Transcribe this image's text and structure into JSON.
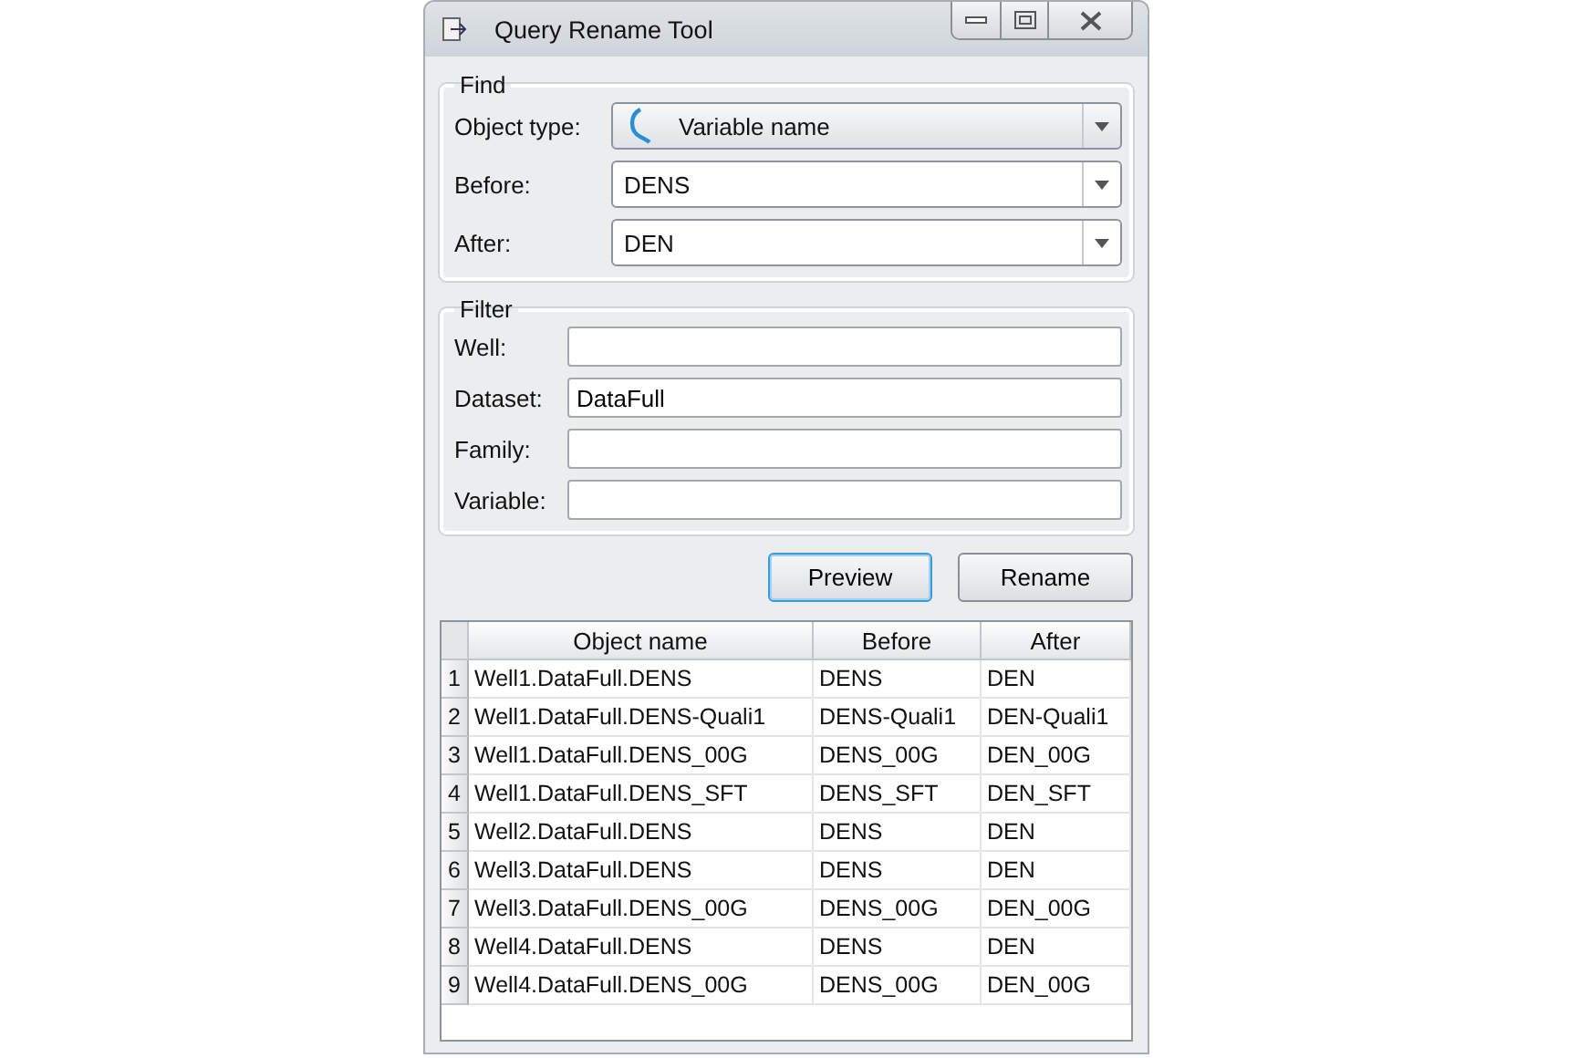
{
  "window": {
    "title": "Query Rename Tool"
  },
  "find": {
    "title": "Find",
    "fields": [
      {
        "label": "Object type:",
        "value": "Variable name",
        "kind": "icon-select"
      },
      {
        "label": "Before:",
        "value": "DENS",
        "kind": "select"
      },
      {
        "label": "After:",
        "value": "DEN",
        "kind": "select"
      }
    ]
  },
  "filter": {
    "title": "Filter",
    "fields": [
      {
        "label": "Well:"
      },
      {
        "label": "Dataset:",
        "value": "DataFull"
      },
      {
        "label": "Family:"
      },
      {
        "label": "Variable:"
      }
    ]
  },
  "buttons": [
    {
      "label": "Preview",
      "focused": true
    },
    {
      "label": "Rename",
      "focused": false
    }
  ],
  "table": {
    "columns": [
      "Object name",
      "Before",
      "After"
    ],
    "rows": [
      {
        "index": "1",
        "cells": [
          "Well1.DataFull.DENS",
          "DENS",
          "DEN"
        ]
      },
      {
        "index": "2",
        "cells": [
          "Well1.DataFull.DENS-Quali1",
          "DENS-Quali1",
          "DEN-Quali1"
        ]
      },
      {
        "index": "3",
        "cells": [
          "Well1.DataFull.DENS_00G",
          "DENS_00G",
          "DEN_00G"
        ]
      },
      {
        "index": "4",
        "cells": [
          "Well1.DataFull.DENS_SFT",
          "DENS_SFT",
          "DEN_SFT"
        ]
      },
      {
        "index": "5",
        "cells": [
          "Well2.DataFull.DENS",
          "DENS",
          "DEN"
        ]
      },
      {
        "index": "6",
        "cells": [
          "Well3.DataFull.DENS",
          "DENS",
          "DEN"
        ]
      },
      {
        "index": "7",
        "cells": [
          "Well3.DataFull.DENS_00G",
          "DENS_00G",
          "DEN_00G"
        ]
      },
      {
        "index": "8",
        "cells": [
          "Well4.DataFull.DENS",
          "DENS",
          "DEN"
        ]
      },
      {
        "index": "9",
        "cells": [
          "Well4.DataFull.DENS_00G",
          "DENS_00G",
          "DEN_00G"
        ]
      }
    ]
  }
}
